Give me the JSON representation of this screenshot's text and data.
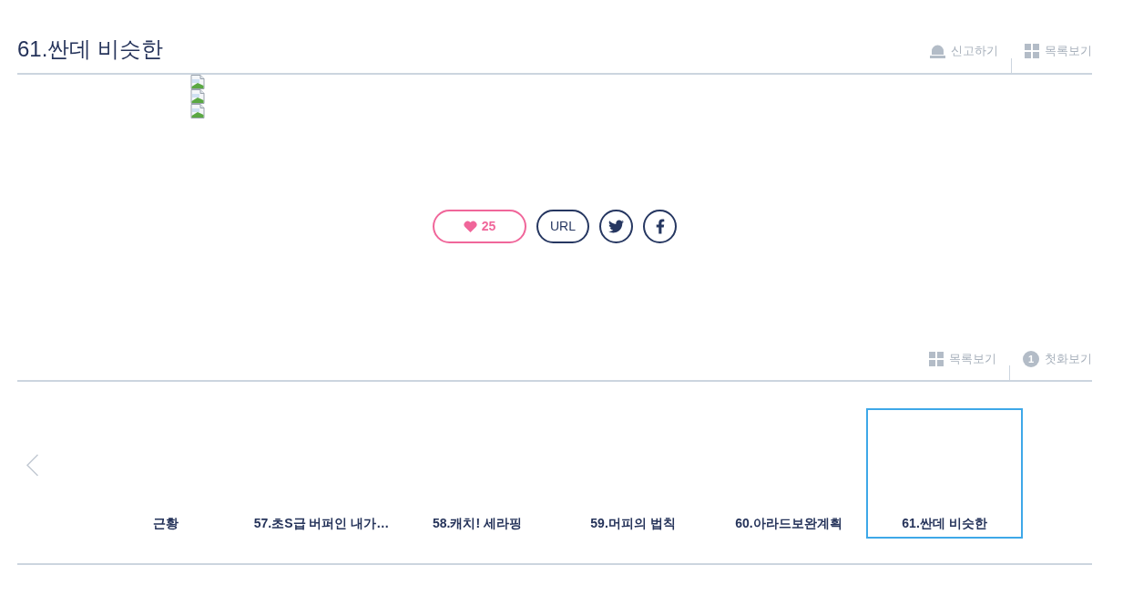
{
  "title": "61.싼데 비슷한",
  "top_actions": [
    {
      "kind": "report",
      "label": "신고하기"
    },
    {
      "kind": "list",
      "label": "목록보기"
    }
  ],
  "content_images": [
    {
      "kind": "broken"
    },
    {
      "kind": "broken"
    },
    {
      "kind": "broken"
    }
  ],
  "like": {
    "count": "25"
  },
  "share": [
    {
      "kind": "url",
      "label": "URL"
    },
    {
      "kind": "twitter"
    },
    {
      "kind": "facebook"
    }
  ],
  "bottom_actions": [
    {
      "kind": "list",
      "label": "목록보기"
    },
    {
      "kind": "first",
      "badge": "1",
      "label": "첫화보기"
    }
  ],
  "episodes": [
    {
      "title": "근황",
      "selected": false
    },
    {
      "title": "57.초S급 버퍼인 내가…",
      "selected": false
    },
    {
      "title": "58.캐치! 세라핑",
      "selected": false
    },
    {
      "title": "59.머피의 법칙",
      "selected": false
    },
    {
      "title": "60.아라드보완계획",
      "selected": false
    },
    {
      "title": "61.싼데 비슷한",
      "selected": true
    }
  ]
}
